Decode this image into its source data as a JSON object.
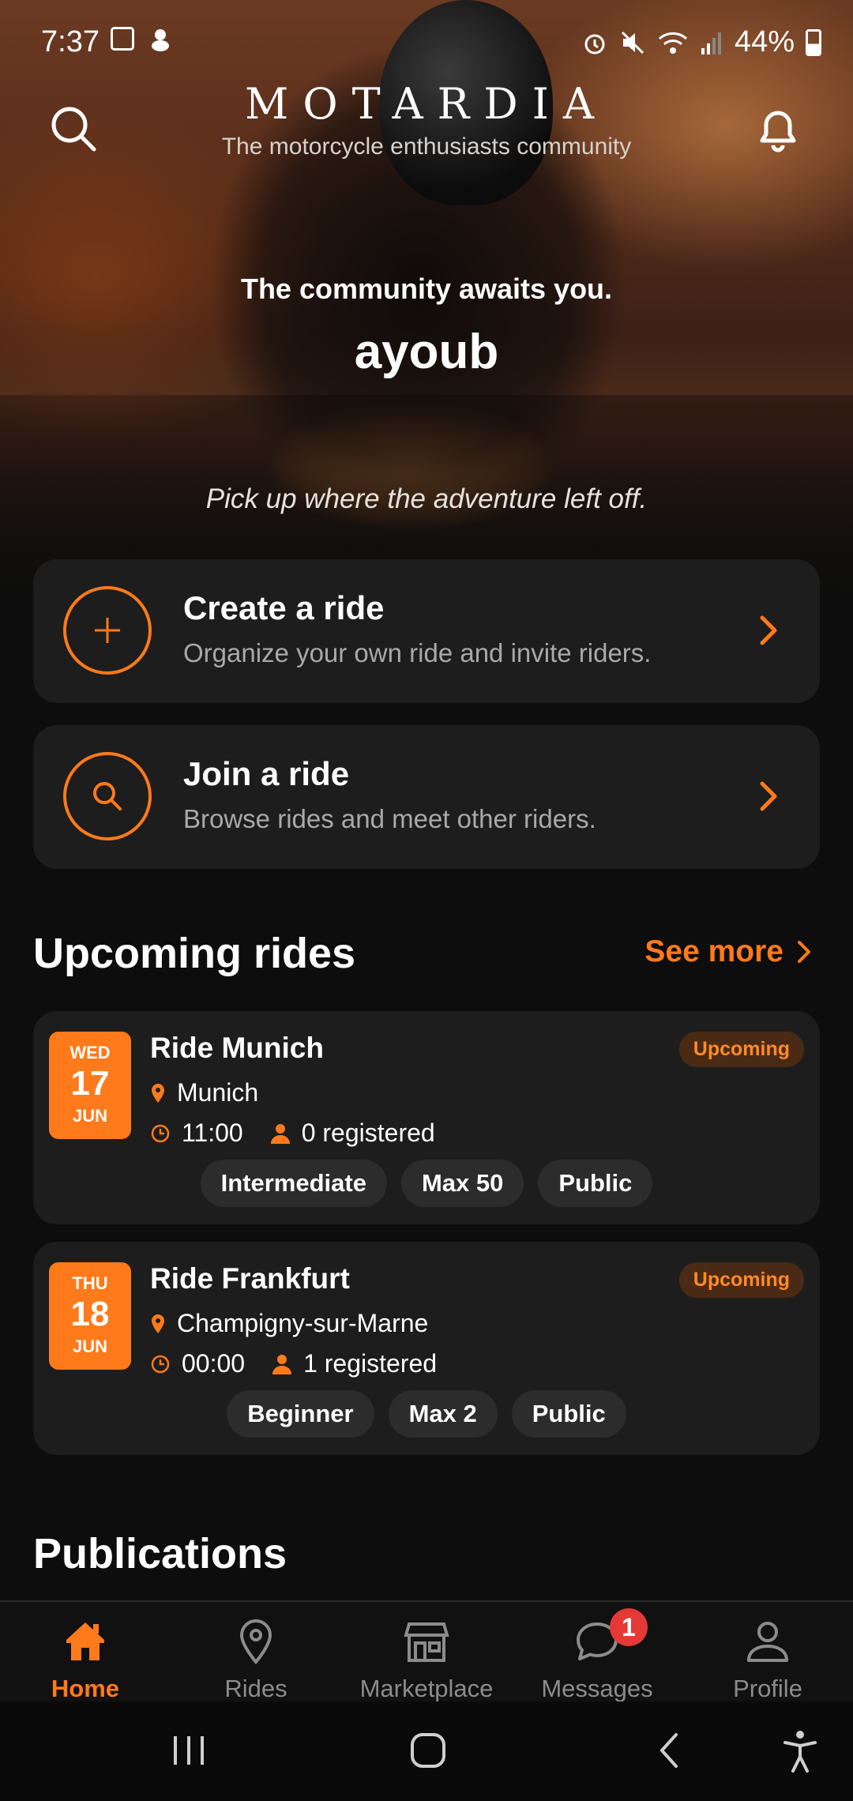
{
  "status_bar": {
    "time": "7:37",
    "battery": "44%"
  },
  "header": {
    "brand": "MOTARDIA",
    "tagline": "The motorcycle enthusiasts community",
    "greeting": "The community awaits you.",
    "username": "ayoub",
    "subtitle": "Pick up where the adventure left off."
  },
  "actions": [
    {
      "title": "Create a ride",
      "subtitle": "Organize your own ride and invite riders.",
      "icon": "plus-icon"
    },
    {
      "title": "Join a ride",
      "subtitle": "Browse rides and meet other riders.",
      "icon": "search-icon"
    }
  ],
  "upcoming": {
    "title": "Upcoming rides",
    "see_more": "See more",
    "rides": [
      {
        "day": "WED",
        "date": "17",
        "month": "JUN",
        "title": "Ride Munich",
        "location": "Munich",
        "time": "11:00",
        "registered": "0 registered",
        "status": "Upcoming",
        "tags": [
          "Intermediate",
          "Max 50",
          "Public"
        ]
      },
      {
        "day": "THU",
        "date": "18",
        "month": "JUN",
        "title": "Ride Frankfurt",
        "location": "Champigny-sur-Marne",
        "time": "00:00",
        "registered": "1 registered",
        "status": "Upcoming",
        "tags": [
          "Beginner",
          "Max 2",
          "Public"
        ]
      }
    ]
  },
  "publications": {
    "title": "Publications"
  },
  "bottom_nav": {
    "items": [
      {
        "label": "Home",
        "icon": "home-icon",
        "active": true
      },
      {
        "label": "Rides",
        "icon": "location-pin-icon"
      },
      {
        "label": "Marketplace",
        "icon": "store-icon"
      },
      {
        "label": "Messages",
        "icon": "chat-bubble-icon",
        "badge": "1"
      },
      {
        "label": "Profile",
        "icon": "user-icon"
      }
    ]
  },
  "colors": {
    "accent": "#ff7a1a",
    "card": "#1d1d1d",
    "background": "#0d0d0d",
    "badge": "#e53935"
  }
}
